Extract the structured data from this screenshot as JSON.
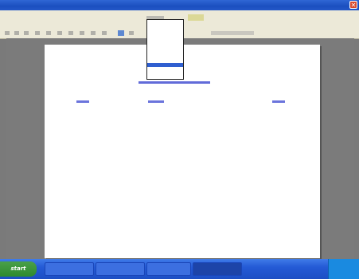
{
  "window": {
    "title": "",
    "close_glyph": "✕"
  },
  "toolbar": {
    "icons": [
      "back-icon",
      "forward-icon",
      "stop-icon",
      "refresh-icon",
      "home-icon",
      "search-icon",
      "favorites-icon",
      "media-icon",
      "history-icon",
      "mail-icon",
      "print-icon",
      "edit-icon"
    ],
    "zoom_value": ""
  },
  "dropdown": {
    "items": [
      "",
      "",
      "",
      "",
      "",
      "",
      ""
    ],
    "selected_index": 5
  },
  "page": {
    "heading_link": "",
    "columns": {
      "name": "",
      "date": "",
      "size": ""
    },
    "rows": [
      {
        "name": "",
        "date": "",
        "size": ""
      },
      {
        "name": "",
        "date": "",
        "size": ""
      },
      {
        "name": "",
        "date": "",
        "size": ""
      },
      {
        "name": "",
        "date": "",
        "size": ""
      },
      {
        "name": "",
        "date": "",
        "size": ""
      },
      {
        "name": "",
        "date": "",
        "size": ""
      },
      {
        "name": "",
        "date": "",
        "size": ""
      },
      {
        "name": "",
        "date": "",
        "size": ""
      },
      {
        "name": "",
        "date": "",
        "size": ""
      },
      {
        "name": "",
        "date": "",
        "size": ""
      }
    ]
  },
  "taskbar": {
    "start_label": "start",
    "tasks": [
      "",
      "",
      "",
      ""
    ],
    "active_index": 3,
    "clock": ""
  }
}
